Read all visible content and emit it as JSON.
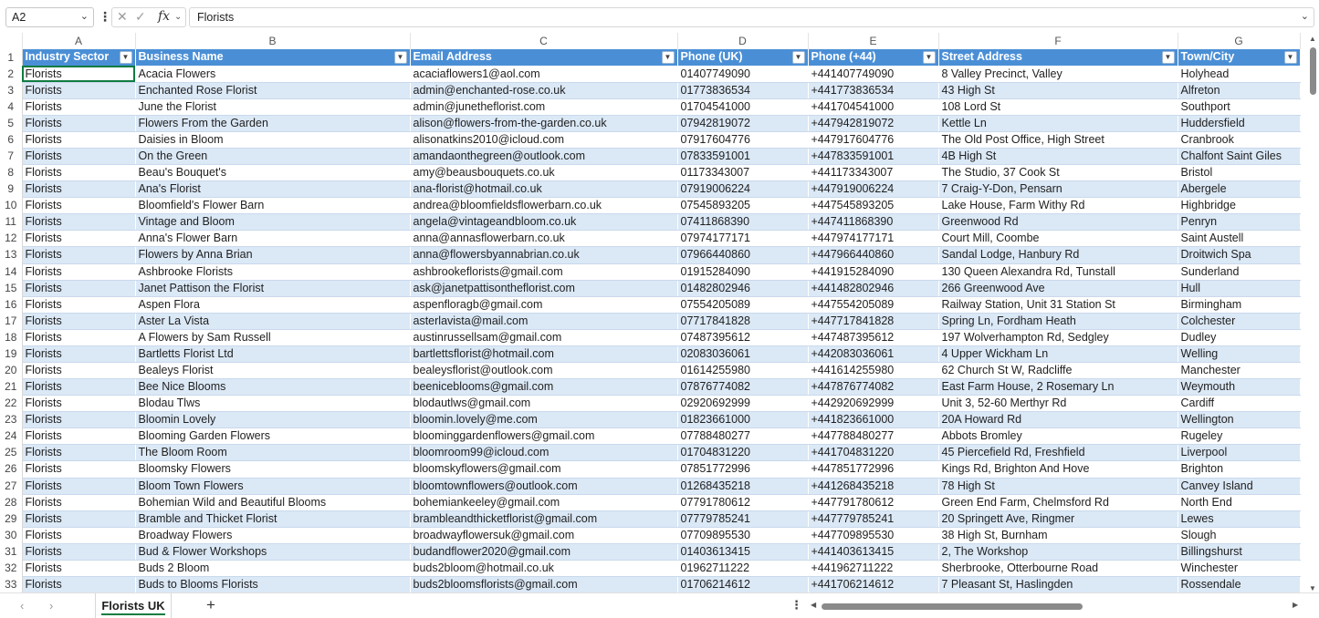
{
  "formula_bar": {
    "name_box": "A2",
    "formula": "Florists"
  },
  "columns": [
    "A",
    "B",
    "C",
    "D",
    "E",
    "F",
    "G"
  ],
  "headers": [
    "Industry Sector",
    "Business Name",
    "Email Address",
    "Phone (UK)",
    "Phone (+44)",
    "Street Address",
    "Town/City"
  ],
  "rows": [
    {
      "n": "2",
      "cells": [
        "Florists",
        "Acacia Flowers",
        "acaciaflowers1@aol.com",
        "01407749090",
        "+441407749090",
        "8 Valley Precinct, Valley",
        "Holyhead"
      ]
    },
    {
      "n": "3",
      "cells": [
        "Florists",
        "Enchanted Rose Florist",
        "admin@enchanted-rose.co.uk",
        "01773836534",
        "+441773836534",
        "43 High St",
        "Alfreton"
      ]
    },
    {
      "n": "4",
      "cells": [
        "Florists",
        "June the Florist",
        "admin@junetheflorist.com",
        "01704541000",
        "+441704541000",
        "108 Lord St",
        "Southport"
      ]
    },
    {
      "n": "5",
      "cells": [
        "Florists",
        "Flowers From the Garden",
        "alison@flowers-from-the-garden.co.uk",
        "07942819072",
        "+447942819072",
        "Kettle Ln",
        "Huddersfield"
      ]
    },
    {
      "n": "6",
      "cells": [
        "Florists",
        "Daisies in Bloom",
        "alisonatkins2010@icloud.com",
        "07917604776",
        "+447917604776",
        "The Old Post Office, High Street",
        "Cranbrook"
      ]
    },
    {
      "n": "7",
      "cells": [
        "Florists",
        "On the Green",
        "amandaonthegreen@outlook.com",
        "07833591001",
        "+447833591001",
        "4B High St",
        "Chalfont Saint Giles"
      ]
    },
    {
      "n": "8",
      "cells": [
        "Florists",
        "Beau's Bouquet's",
        "amy@beausbouquets.co.uk",
        "01173343007",
        "+441173343007",
        "The Studio, 37 Cook St",
        "Bristol"
      ]
    },
    {
      "n": "9",
      "cells": [
        "Florists",
        "Ana's Florist",
        "ana-florist@hotmail.co.uk",
        "07919006224",
        "+447919006224",
        "7 Craig-Y-Don, Pensarn",
        "Abergele"
      ]
    },
    {
      "n": "10",
      "cells": [
        "Florists",
        "Bloomfield's Flower Barn",
        "andrea@bloomfieldsflowerbarn.co.uk",
        "07545893205",
        "+447545893205",
        "Lake House, Farm Withy Rd",
        "Highbridge"
      ]
    },
    {
      "n": "11",
      "cells": [
        "Florists",
        "Vintage and Bloom",
        "angela@vintageandbloom.co.uk",
        "07411868390",
        "+447411868390",
        "Greenwood Rd",
        "Penryn"
      ]
    },
    {
      "n": "12",
      "cells": [
        "Florists",
        "Anna's Flower Barn",
        "anna@annasflowerbarn.co.uk",
        "07974177171",
        "+447974177171",
        "Court Mill, Coombe",
        "Saint Austell"
      ]
    },
    {
      "n": "13",
      "cells": [
        "Florists",
        "Flowers by Anna Brian",
        "anna@flowersbyannabrian.co.uk",
        "07966440860",
        "+447966440860",
        "Sandal Lodge, Hanbury Rd",
        "Droitwich Spa"
      ]
    },
    {
      "n": "14",
      "cells": [
        "Florists",
        "Ashbrooke Florists",
        "ashbrookeflorists@gmail.com",
        "01915284090",
        "+441915284090",
        "130 Queen Alexandra Rd, Tunstall",
        "Sunderland"
      ]
    },
    {
      "n": "15",
      "cells": [
        "Florists",
        "Janet Pattison the Florist",
        "ask@janetpattisontheflorist.com",
        "01482802946",
        "+441482802946",
        "266 Greenwood Ave",
        "Hull"
      ]
    },
    {
      "n": "16",
      "cells": [
        "Florists",
        "Aspen Flora",
        "aspenfloragb@gmail.com",
        "07554205089",
        "+447554205089",
        "Railway Station, Unit 31 Station St",
        "Birmingham"
      ]
    },
    {
      "n": "17",
      "cells": [
        "Florists",
        "Aster La Vista",
        "asterlavista@mail.com",
        "07717841828",
        "+447717841828",
        "Spring Ln, Fordham Heath",
        "Colchester"
      ]
    },
    {
      "n": "18",
      "cells": [
        "Florists",
        "A Flowers by Sam Russell",
        "austinrussellsam@gmail.com",
        "07487395612",
        "+447487395612",
        "197 Wolverhampton Rd, Sedgley",
        "Dudley"
      ]
    },
    {
      "n": "19",
      "cells": [
        "Florists",
        "Bartletts Florist Ltd",
        "bartlettsflorist@hotmail.com",
        "02083036061",
        "+442083036061",
        "4 Upper Wickham Ln",
        "Welling"
      ]
    },
    {
      "n": "20",
      "cells": [
        "Florists",
        "Bealeys Florist",
        "bealeysflorist@outlook.com",
        "01614255980",
        "+441614255980",
        "62 Church St W, Radcliffe",
        "Manchester"
      ]
    },
    {
      "n": "21",
      "cells": [
        "Florists",
        "Bee Nice Blooms",
        "beeniceblooms@gmail.com",
        "07876774082",
        "+447876774082",
        "East Farm House, 2 Rosemary Ln",
        "Weymouth"
      ]
    },
    {
      "n": "22",
      "cells": [
        "Florists",
        "Blodau Tlws",
        "blodautlws@gmail.com",
        "02920692999",
        "+442920692999",
        "Unit 3, 52-60 Merthyr Rd",
        "Cardiff"
      ]
    },
    {
      "n": "23",
      "cells": [
        "Florists",
        "Bloomin Lovely",
        "bloomin.lovely@me.com",
        "01823661000",
        "+441823661000",
        "20A Howard Rd",
        "Wellington"
      ]
    },
    {
      "n": "24",
      "cells": [
        "Florists",
        "Blooming Garden Flowers",
        "bloominggardenflowers@gmail.com",
        "07788480277",
        "+447788480277",
        "Abbots Bromley",
        "Rugeley"
      ]
    },
    {
      "n": "25",
      "cells": [
        "Florists",
        "The Bloom Room",
        "bloomroom99@icloud.com",
        "01704831220",
        "+441704831220",
        "45 Piercefield Rd, Freshfield",
        "Liverpool"
      ]
    },
    {
      "n": "26",
      "cells": [
        "Florists",
        "Bloomsky Flowers",
        "bloomskyflowers@gmail.com",
        "07851772996",
        "+447851772996",
        "Kings Rd, Brighton And Hove",
        "Brighton"
      ]
    },
    {
      "n": "27",
      "cells": [
        "Florists",
        "Bloom Town Flowers",
        "bloomtownflowers@outlook.com",
        "01268435218",
        "+441268435218",
        "78 High St",
        "Canvey Island"
      ]
    },
    {
      "n": "28",
      "cells": [
        "Florists",
        "Bohemian Wild and Beautiful Blooms",
        "bohemiankeeley@gmail.com",
        "07791780612",
        "+447791780612",
        "Green End Farm, Chelmsford Rd",
        "North End"
      ]
    },
    {
      "n": "29",
      "cells": [
        "Florists",
        "Bramble and Thicket Florist",
        "brambleandthicketflorist@gmail.com",
        "07779785241",
        "+447779785241",
        "20 Springett Ave, Ringmer",
        "Lewes"
      ]
    },
    {
      "n": "30",
      "cells": [
        "Florists",
        "Broadway Flowers",
        "broadwayflowersuk@gmail.com",
        "07709895530",
        "+447709895530",
        "38 High St, Burnham",
        "Slough"
      ]
    },
    {
      "n": "31",
      "cells": [
        "Florists",
        "Bud & Flower Workshops",
        "budandflower2020@gmail.com",
        "01403613415",
        "+441403613415",
        "2, The Workshop",
        "Billingshurst"
      ]
    },
    {
      "n": "32",
      "cells": [
        "Florists",
        "Buds 2 Bloom",
        "buds2bloom@hotmail.co.uk",
        "01962711222",
        "+441962711222",
        "Sherbrooke, Otterbourne Road",
        "Winchester"
      ]
    },
    {
      "n": "33",
      "cells": [
        "Florists",
        "Buds to Blooms Florists",
        "buds2bloomsflorists@gmail.com",
        "01706214612",
        "+441706214612",
        "7 Pleasant St, Haslingden",
        "Rossendale"
      ]
    }
  ],
  "sheet_tab": "Florists UK",
  "colors": {
    "header_bg": "#4a8fd6",
    "band_bg": "#dbe8f6",
    "accent": "#107c41"
  }
}
